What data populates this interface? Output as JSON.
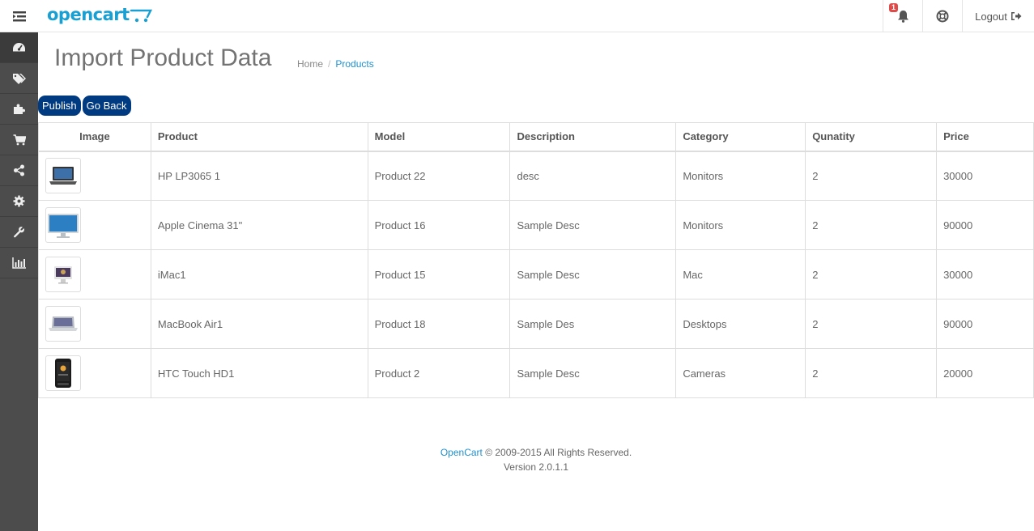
{
  "header": {
    "logo_text": "opencart",
    "notification_count": "1",
    "logout_label": "Logout"
  },
  "page": {
    "title": "Import Product Data",
    "breadcrumb": [
      "Home",
      "/",
      "Products"
    ]
  },
  "actions": {
    "publish_label": "Publish",
    "go_back_label": "Go Back"
  },
  "table": {
    "columns": [
      "Image",
      "Product",
      "Model",
      "Description",
      "Category",
      "Qunatity",
      "Price"
    ],
    "rows": [
      {
        "image": "laptop-icon",
        "product": "HP LP3065 1",
        "model": "Product 22",
        "description": "desc",
        "category": "Monitors",
        "quantity": "2",
        "price": "30000"
      },
      {
        "image": "monitor-icon",
        "product": "Apple Cinema 31\"",
        "model": "Product 16",
        "description": "Sample Desc",
        "category": "Monitors",
        "quantity": "2",
        "price": "90000"
      },
      {
        "image": "imac-icon",
        "product": "iMac1",
        "model": "Product 15",
        "description": "Sample Desc",
        "category": "Mac",
        "quantity": "2",
        "price": "30000"
      },
      {
        "image": "macbook-icon",
        "product": "MacBook Air1",
        "model": "Product 18",
        "description": "Sample Des",
        "category": "Desktops",
        "quantity": "2",
        "price": "90000"
      },
      {
        "image": "phone-icon",
        "product": "HTC Touch HD1",
        "model": "Product 2",
        "description": "Sample Desc",
        "category": "Cameras",
        "quantity": "2",
        "price": "20000"
      }
    ]
  },
  "footer": {
    "brand": "OpenCart",
    "copyright": " © 2009-2015 All Rights Reserved.",
    "version": "Version 2.0.1.1"
  },
  "sidebar": {
    "icons": [
      "dashboard-icon",
      "tags-icon",
      "puzzle-icon",
      "cart-icon",
      "share-icon",
      "gear-icon",
      "wrench-icon",
      "bar-chart-icon"
    ]
  },
  "colors": {
    "accent": "#1e91cf",
    "button": "#003a80",
    "sidebar": "#4c4c4c",
    "badge": "#e04b4a"
  }
}
